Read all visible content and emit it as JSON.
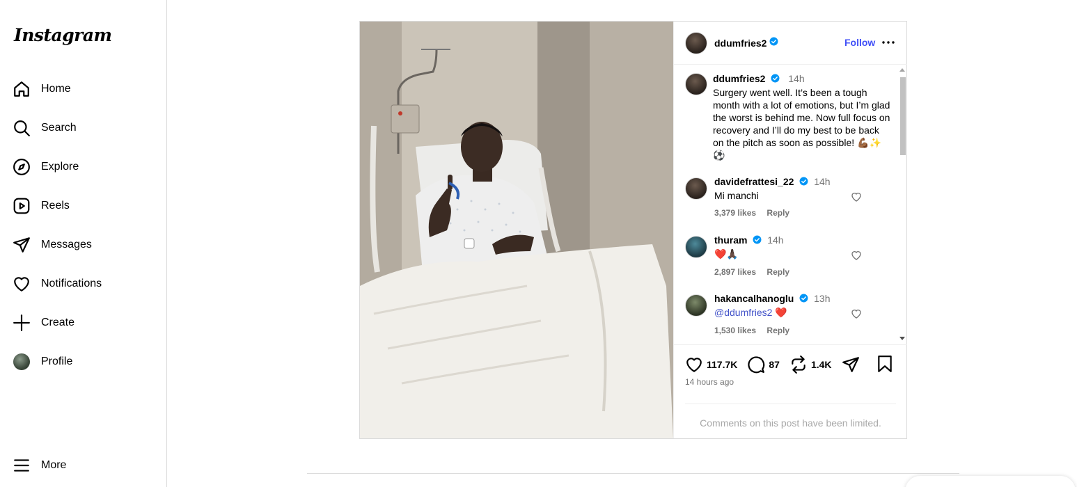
{
  "app": {
    "logo_text": "Instagram"
  },
  "sidebar": {
    "items": [
      {
        "label": "Home",
        "icon": "home-icon"
      },
      {
        "label": "Search",
        "icon": "search-icon"
      },
      {
        "label": "Explore",
        "icon": "compass-icon"
      },
      {
        "label": "Reels",
        "icon": "reels-icon"
      },
      {
        "label": "Messages",
        "icon": "paper-plane-icon"
      },
      {
        "label": "Notifications",
        "icon": "heart-icon"
      },
      {
        "label": "Create",
        "icon": "plus-icon"
      },
      {
        "label": "Profile",
        "icon": "avatar"
      }
    ],
    "more_label": "More"
  },
  "post": {
    "author": "ddumfries2",
    "follow_label": "Follow",
    "caption": {
      "username": "ddumfries2",
      "time": "14h",
      "text": "Surgery went well. It’s been a tough month with a lot of emotions, but I’m glad the worst is behind me. Now full focus on recovery and I’ll do my best to be back on the pitch as soon as possible! 💪🏾✨⚽"
    },
    "comments": [
      {
        "username": "davidefrattesi_22",
        "time": "14h",
        "text": "Mi manchi",
        "likes": "3,379 likes",
        "reply": "Reply"
      },
      {
        "username": "thuram",
        "time": "14h",
        "text": "❤️🙏🏿",
        "likes": "2,897 likes",
        "reply": "Reply"
      },
      {
        "username": "hakancalhanoglu",
        "time": "13h",
        "mention": "@ddumfries2",
        "text": " ❤️",
        "likes": "1,530 likes",
        "reply": "Reply"
      }
    ],
    "stats": {
      "likes": "117.7K",
      "comments": "87",
      "reposts": "1.4K"
    },
    "posted_ago": "14 hours ago",
    "limited_notice": "Comments on this post have been limited."
  },
  "colors": {
    "accent": "#4150f7",
    "verified": "#0095f6",
    "border": "#dbdbdb",
    "muted": "#737373"
  }
}
